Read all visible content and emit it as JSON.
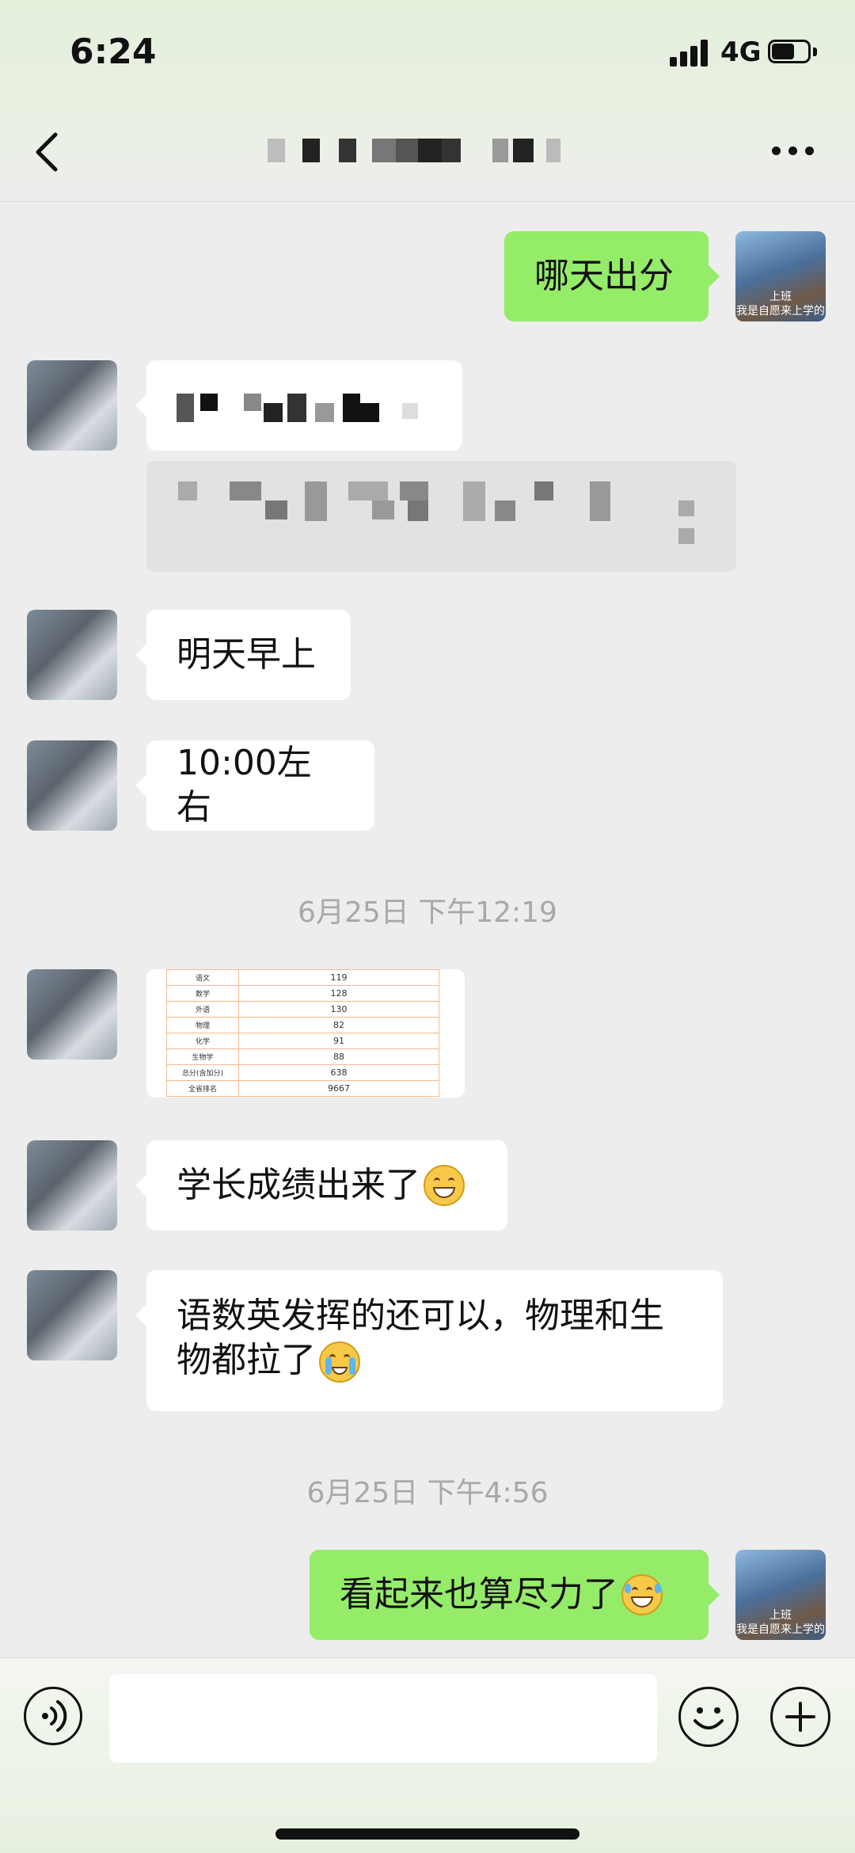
{
  "status_bar": {
    "time": "6:24",
    "network": "4G"
  },
  "header": {
    "back_icon": "chevron-left-icon",
    "more_icon": "more-dots-icon"
  },
  "messages": {
    "m1": {
      "text": "哪天出分",
      "sender": "me"
    },
    "m3": {
      "text": "明天早上"
    },
    "m4": {
      "text": "10:00左右"
    },
    "m6": {
      "text": "学长成绩出来了"
    },
    "m7": {
      "text": "语数英发挥的还可以，物理和生物都拉了"
    },
    "m8": {
      "text": "看起来也算尽力了"
    }
  },
  "timestamps": [
    "6月25日 下午12:19",
    "6月25日 下午4:56"
  ],
  "score_image": {
    "rows": [
      {
        "subject": "语文",
        "score": "119"
      },
      {
        "subject": "数学",
        "score": "128"
      },
      {
        "subject": "外语",
        "score": "130"
      },
      {
        "subject": "物理",
        "score": "82"
      },
      {
        "subject": "化学",
        "score": "91"
      },
      {
        "subject": "生物学",
        "score": "88"
      },
      {
        "subject": "总分(含加分)",
        "score": "638"
      },
      {
        "subject": "全省排名",
        "score": "9667"
      }
    ]
  },
  "avatars": {
    "me_caption_top": "上班",
    "me_caption": "我是自愿来上学的"
  },
  "emoji_names": {
    "grin": "grinning-emoji",
    "cry": "crying-emoji",
    "laugh": "laughing-emoji"
  },
  "colors": {
    "chat_bg": "#ededed",
    "my_bubble": "#95ec69",
    "their_bubble": "#ffffff",
    "timestamp": "#a8a8a8"
  }
}
